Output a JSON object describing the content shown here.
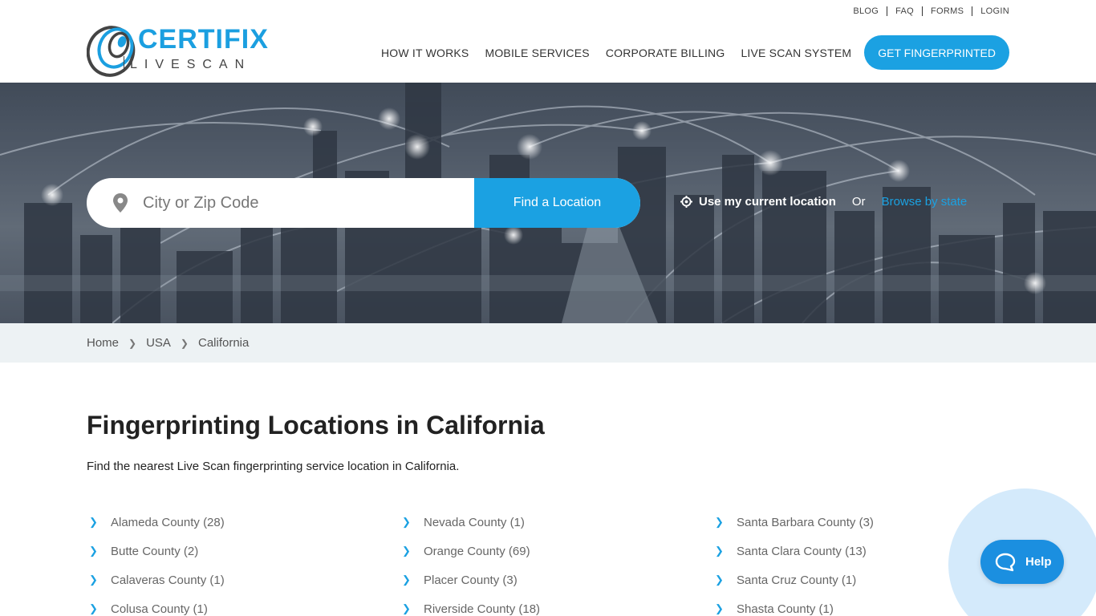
{
  "header": {
    "top_links": [
      "BLOG",
      "FAQ",
      "FORMS",
      "LOGIN"
    ],
    "logo": {
      "brand": "CERTIFIX",
      "sub": "LIVESCAN"
    },
    "nav": [
      "HOW IT WORKS",
      "MOBILE SERVICES",
      "CORPORATE BILLING",
      "LIVE SCAN SYSTEM"
    ],
    "cta_label": "GET FINGERPRINTED"
  },
  "hero": {
    "search_placeholder": "City or Zip Code",
    "search_value": "",
    "find_label": "Find a Location",
    "current_location_label": "Use my current location",
    "or_label": "Or",
    "browse_label": "Browse by state"
  },
  "breadcrumb": [
    "Home",
    "USA",
    "California"
  ],
  "main": {
    "title": "Fingerprinting Locations in California",
    "description": "Find the nearest Live Scan fingerprinting service location in California.",
    "columns": [
      [
        "Alameda County (28)",
        "Butte County (2)",
        "Calaveras County (1)",
        "Colusa County (1)"
      ],
      [
        "Nevada County (1)",
        "Orange County (69)",
        "Placer County (3)",
        "Riverside County (18)"
      ],
      [
        "Santa Barbara County (3)",
        "Santa Clara County (13)",
        "Santa Cruz County (1)",
        "Shasta County (1)"
      ]
    ]
  },
  "help": {
    "label": "Help"
  },
  "colors": {
    "accent": "#1ba1e2",
    "breadcrumb_bg": "#edf2f4",
    "help_blue": "#1b8fe0"
  },
  "icons": {
    "pin": "map-pin-icon",
    "crosshair": "crosshair-icon",
    "chevron": "chevron-right-icon",
    "help": "chat-bubble-icon"
  }
}
